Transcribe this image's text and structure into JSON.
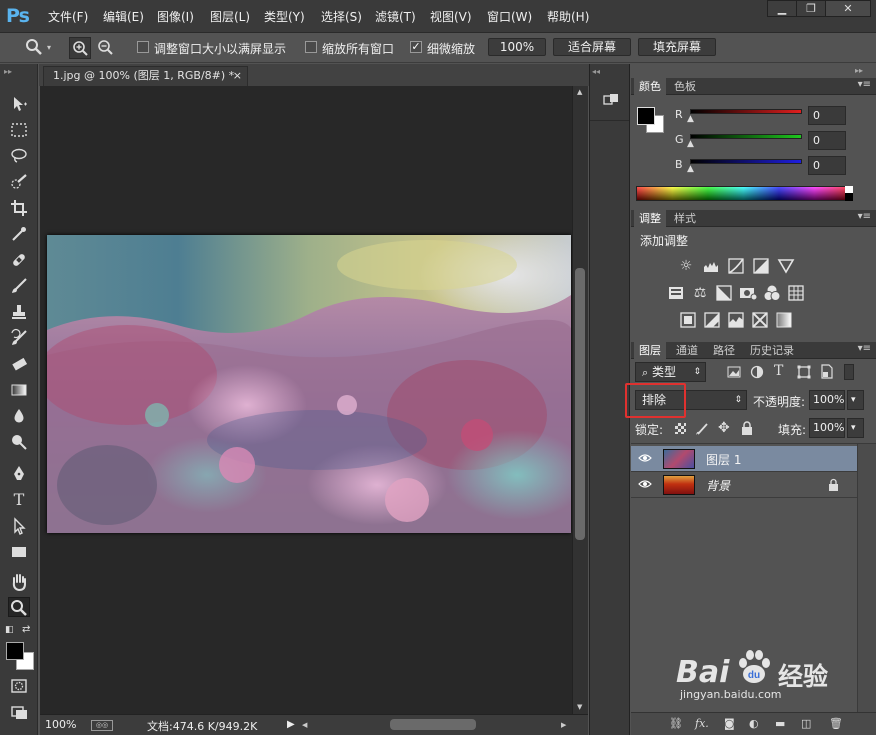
{
  "app": {
    "logo": "Ps"
  },
  "menu": {
    "items": [
      "文件(F)",
      "编辑(E)",
      "图像(I)",
      "图层(L)",
      "类型(Y)",
      "选择(S)",
      "滤镜(T)",
      "视图(V)",
      "窗口(W)",
      "帮助(H)"
    ]
  },
  "window_controls": {
    "minimize": "▁",
    "restore": "❐",
    "close": "✕"
  },
  "options_bar": {
    "resize_windows_label": "调整窗口大小以满屏显示",
    "zoom_all_label": "缩放所有窗口",
    "scrubby_zoom_label": "细微缩放",
    "scrubby_zoom_checked": true,
    "zoom_100_button": "100%",
    "fit_screen_button": "适合屏幕",
    "fill_screen_button": "填充屏幕"
  },
  "document": {
    "tab_title": "1.jpg @ 100% (图层 1, RGB/8#) *",
    "tab_close": "×",
    "zoom": "100%",
    "doc_info": "文档:474.6 K/949.2K"
  },
  "color_panel": {
    "tabs": [
      "颜色",
      "色板"
    ],
    "active_tab": "颜色",
    "channels": [
      {
        "label": "R",
        "value": "0",
        "color": "#d62020"
      },
      {
        "label": "G",
        "value": "0",
        "color": "#20c020"
      },
      {
        "label": "B",
        "value": "0",
        "color": "#2020d6"
      }
    ],
    "foreground": "#000000",
    "background": "#ffffff"
  },
  "adjustments_panel": {
    "tabs": [
      "调整",
      "样式"
    ],
    "active_tab": "调整",
    "heading": "添加调整",
    "icons": [
      "brightness-icon",
      "levels-icon",
      "curves-icon",
      "exposure-icon",
      "vibrance-icon",
      "hue-saturation-icon",
      "color-balance-icon",
      "black-white-icon",
      "photo-filter-icon",
      "channel-mixer-icon",
      "color-lookup-icon",
      "invert-icon",
      "posterize-icon",
      "threshold-icon",
      "selective-color-icon",
      "gradient-map-icon"
    ]
  },
  "layers_panel": {
    "tabs": [
      "图层",
      "通道",
      "路径",
      "历史记录"
    ],
    "active_tab": "图层",
    "filter_kind": "类型",
    "blend_mode": "排除",
    "opacity_label": "不透明度:",
    "opacity": "100%",
    "lock_label": "锁定:",
    "fill_label": "填充:",
    "fill": "100%",
    "layers": [
      {
        "name": "图层 1",
        "selected": true,
        "locked": false
      },
      {
        "name": "背景",
        "selected": false,
        "locked": true
      }
    ]
  },
  "watermark": {
    "text": "Bai",
    "suffix": "经验",
    "url": "jingyan.baidu.com"
  }
}
